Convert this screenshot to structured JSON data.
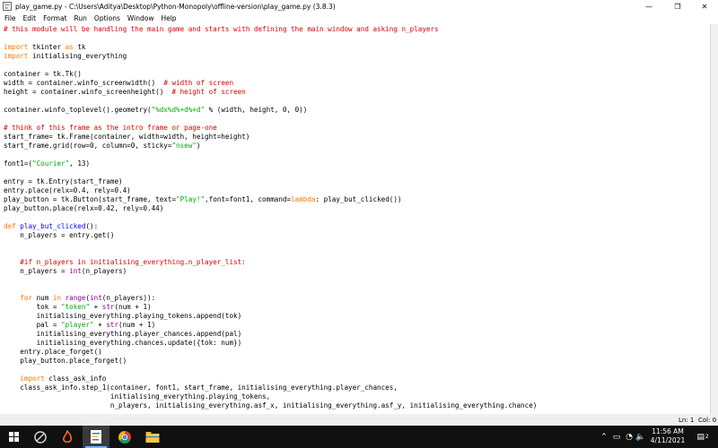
{
  "window": {
    "title": "play_game.py - C:\\Users\\Aditya\\Desktop\\Python-Monopoly\\offline-version\\play_game.py (3.8.3)",
    "minimize_glyph": "—",
    "maximize_glyph": "❐",
    "close_glyph": "✕"
  },
  "menu": [
    "File",
    "Edit",
    "Format",
    "Run",
    "Options",
    "Window",
    "Help"
  ],
  "colors": {
    "comment": "#dd0000",
    "keyword": "#ff7700",
    "string": "#00aa00",
    "builtin": "#900090",
    "definition": "#0000ff",
    "default": "#000000"
  },
  "code_lines": [
    [
      [
        "comment",
        "# this module will be handling the main game and starts with defining the main window and asking n_players"
      ]
    ],
    [],
    [
      [
        "keyword",
        "import"
      ],
      [
        "default",
        " tkinter "
      ],
      [
        "keyword",
        "as"
      ],
      [
        "default",
        " tk"
      ]
    ],
    [
      [
        "keyword",
        "import"
      ],
      [
        "default",
        " initialising_everything"
      ]
    ],
    [],
    [
      [
        "default",
        "container = tk.Tk()"
      ]
    ],
    [
      [
        "default",
        "width = container.winfo_screenwidth()  "
      ],
      [
        "comment",
        "# width of screen"
      ]
    ],
    [
      [
        "default",
        "height = container.winfo_screenheight()  "
      ],
      [
        "comment",
        "# height of screen"
      ]
    ],
    [],
    [
      [
        "default",
        "container.winfo_toplevel().geometry("
      ],
      [
        "string",
        "\"%dx%d%+d%+d\""
      ],
      [
        "default",
        " % (width, height, 0, 0))"
      ]
    ],
    [],
    [
      [
        "comment",
        "# think of this frame as the intro frame or page-one"
      ]
    ],
    [
      [
        "default",
        "start_frame= tk.Frame(container, width=width, height=height)"
      ]
    ],
    [
      [
        "default",
        "start_frame.grid(row=0, column=0, sticky="
      ],
      [
        "string",
        "\"nsew\""
      ],
      [
        "default",
        ")"
      ]
    ],
    [],
    [
      [
        "default",
        "font1=("
      ],
      [
        "string",
        "\"Courier\""
      ],
      [
        "default",
        ", 13)"
      ]
    ],
    [],
    [
      [
        "default",
        "entry = tk.Entry(start_frame)"
      ]
    ],
    [
      [
        "default",
        "entry.place(relx=0.4, rely=0.4)"
      ]
    ],
    [
      [
        "default",
        "play_button = tk.Button(start_frame, text="
      ],
      [
        "string",
        "\"Play!\""
      ],
      [
        "default",
        ",font=font1, command="
      ],
      [
        "keyword",
        "lambda"
      ],
      [
        "default",
        ": play_but_clicked())"
      ]
    ],
    [
      [
        "default",
        "play_button.place(relx=0.42, rely=0.44)"
      ]
    ],
    [],
    [
      [
        "keyword",
        "def"
      ],
      [
        "default",
        " "
      ],
      [
        "definition",
        "play_but_clicked"
      ],
      [
        "default",
        "():"
      ]
    ],
    [
      [
        "default",
        "    n_players = entry.get()"
      ]
    ],
    [],
    [],
    [
      [
        "default",
        "    "
      ],
      [
        "comment",
        "#if n_players in initialising_everything.n_player_list:"
      ]
    ],
    [
      [
        "default",
        "    n_players = "
      ],
      [
        "builtin",
        "int"
      ],
      [
        "default",
        "(n_players)"
      ]
    ],
    [],
    [],
    [
      [
        "default",
        "    "
      ],
      [
        "keyword",
        "for"
      ],
      [
        "default",
        " num "
      ],
      [
        "keyword",
        "in"
      ],
      [
        "default",
        " "
      ],
      [
        "builtin",
        "range"
      ],
      [
        "default",
        "("
      ],
      [
        "builtin",
        "int"
      ],
      [
        "default",
        "(n_players)):"
      ]
    ],
    [
      [
        "default",
        "        tok = "
      ],
      [
        "string",
        "\"token\""
      ],
      [
        "default",
        " + "
      ],
      [
        "builtin",
        "str"
      ],
      [
        "default",
        "(num + 1)"
      ]
    ],
    [
      [
        "default",
        "        initialising_everything.playing_tokens.append(tok)"
      ]
    ],
    [
      [
        "default",
        "        pal = "
      ],
      [
        "string",
        "\"player\""
      ],
      [
        "default",
        " + "
      ],
      [
        "builtin",
        "str"
      ],
      [
        "default",
        "(num + 1)"
      ]
    ],
    [
      [
        "default",
        "        initialising_everything.player_chances.append(pal)"
      ]
    ],
    [
      [
        "default",
        "        initialising_everything.chances.update({tok: num})"
      ]
    ],
    [
      [
        "default",
        "    entry.place_forget()"
      ]
    ],
    [
      [
        "default",
        "    play_button.place_forget()"
      ]
    ],
    [],
    [
      [
        "default",
        "    "
      ],
      [
        "keyword",
        "import"
      ],
      [
        "default",
        " class_ask_info"
      ]
    ],
    [
      [
        "default",
        "    class_ask_info.step_1(container, font1, start_frame, initialising_everything.player_chances,"
      ]
    ],
    [
      [
        "default",
        "                          initialising_everything.playing_tokens,"
      ]
    ],
    [
      [
        "default",
        "                          n_players, initialising_everything.asf_x, initialising_everything.asf_y, initialising_everything.chance)"
      ]
    ]
  ],
  "status": {
    "line": "Ln: 1",
    "col": "Col: 0"
  },
  "taskbar": {
    "time": "11:56 AM",
    "date": "4/11/2021",
    "notification_count": "2",
    "tray_chevron": "⌃",
    "network_glyph": "▭",
    "wifi_glyph": "◔",
    "volume_glyph": "🔈",
    "notification_glyph": "▤"
  }
}
